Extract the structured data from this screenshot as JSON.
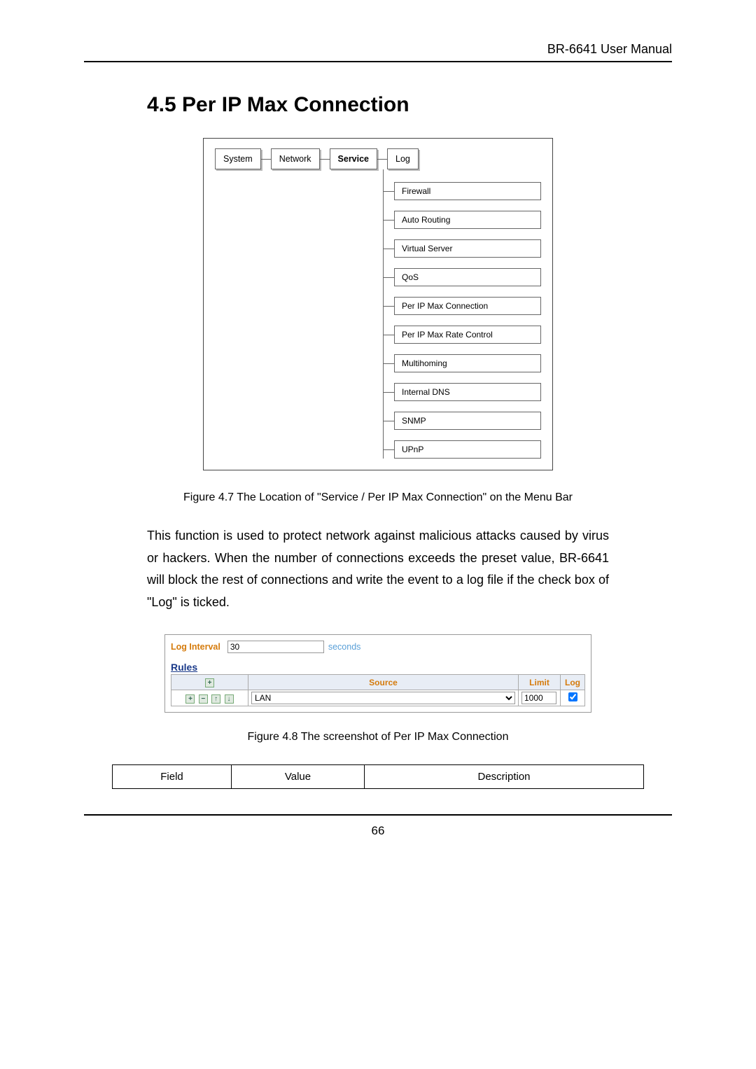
{
  "header": {
    "manual_title": "BR-6641 User Manual"
  },
  "section": {
    "title": "4.5 Per IP Max Connection"
  },
  "menu": {
    "tabs": [
      "System",
      "Network",
      "Service",
      "Log"
    ],
    "active": "Service",
    "submenu": [
      "Firewall",
      "Auto Routing",
      "Virtual Server",
      "QoS",
      "Per IP Max Connection",
      "Per IP Max Rate Control",
      "Multihoming",
      "Internal DNS",
      "SNMP",
      "UPnP"
    ]
  },
  "caption1": "Figure 4.7 The Location of \"Service / Per IP Max Connection\" on the Menu Bar",
  "body_text": "This function is used to protect network against malicious attacks caused by virus or hackers. When the number of connections exceeds the preset value, BR-6641 will block the rest of connections and write the event to a log file if the check box of \"Log\" is ticked.",
  "rules_panel": {
    "log_interval_label": "Log Interval",
    "log_interval_value": "30",
    "seconds_label": "seconds",
    "rules_heading": "Rules",
    "headers": {
      "action": "",
      "source": "Source",
      "limit": "Limit",
      "log": "Log"
    },
    "row": {
      "source_value": "LAN",
      "limit_value": "1000",
      "log_checked": true
    },
    "icons": {
      "add": "+",
      "remove": "−",
      "up": "↑",
      "down": "↓"
    }
  },
  "caption2": "Figure 4.8 The screenshot of Per IP Max Connection",
  "desc_table": {
    "col1": "Field",
    "col2": "Value",
    "col3": "Description"
  },
  "page_number": "66"
}
